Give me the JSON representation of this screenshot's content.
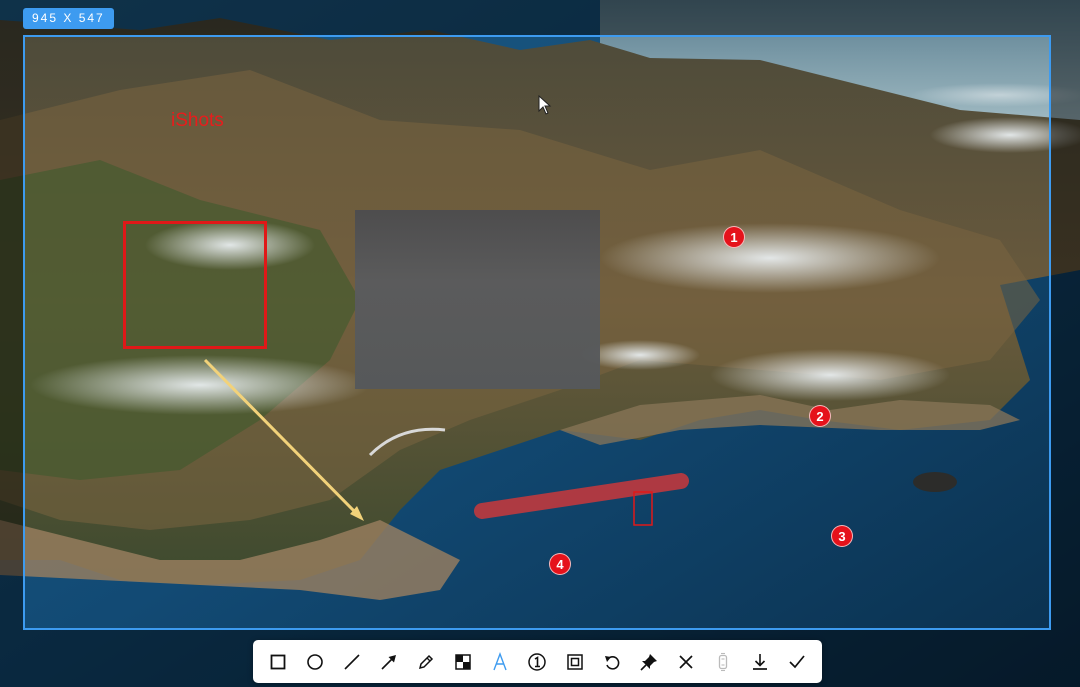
{
  "app": {
    "name": "iShots"
  },
  "selection": {
    "size_label": "945  X  547"
  },
  "annotations": {
    "text_label": "iShots",
    "numbers": [
      "1",
      "2",
      "3",
      "4"
    ]
  },
  "colors": {
    "accent": "#3d9bf0",
    "annotation_red": "#e01818",
    "arrow_yellow": "#f2d27a"
  },
  "toolbar": {
    "tools": [
      {
        "name": "rectangle-tool",
        "icon": "square-icon"
      },
      {
        "name": "ellipse-tool",
        "icon": "circle-icon"
      },
      {
        "name": "line-tool",
        "icon": "line-icon"
      },
      {
        "name": "arrow-tool",
        "icon": "arrow-icon"
      },
      {
        "name": "pencil-tool",
        "icon": "pencil-icon"
      },
      {
        "name": "mosaic-tool",
        "icon": "mosaic-icon"
      },
      {
        "name": "text-tool",
        "icon": "text-icon"
      },
      {
        "name": "number-tool",
        "icon": "numbered-circle-icon"
      },
      {
        "name": "blur-tool",
        "icon": "blur-frame-icon"
      },
      {
        "name": "undo-button",
        "icon": "undo-icon"
      },
      {
        "name": "pin-button",
        "icon": "pin-icon"
      },
      {
        "name": "cancel-button",
        "icon": "close-icon"
      },
      {
        "name": "ocr-button",
        "icon": "scroll-capture-icon"
      },
      {
        "name": "save-button",
        "icon": "download-icon"
      },
      {
        "name": "confirm-button",
        "icon": "checkmark-icon"
      }
    ]
  }
}
